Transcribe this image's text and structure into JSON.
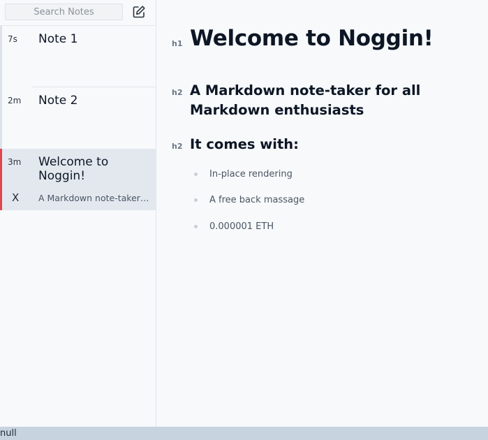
{
  "search": {
    "placeholder": "Search Notes"
  },
  "sidebar": {
    "new_note_icon": "edit-icon",
    "notes": [
      {
        "age": "7s",
        "title": "Note 1",
        "active": false
      },
      {
        "age": "2m",
        "title": "Note 2",
        "active": false
      },
      {
        "age": "3m",
        "title": "Welcome to Noggin!",
        "active": true,
        "delete_label": "X",
        "preview": "A Markdown note-taker for all Markdown enthusiasts"
      }
    ]
  },
  "document": {
    "h1": {
      "tag": "h1",
      "text": "Welcome to Noggin!"
    },
    "h2_first": {
      "tag": "h2",
      "text": "A Markdown note-taker for all Markdown enthusiasts"
    },
    "h2_second": {
      "tag": "h2",
      "text": "It comes with:"
    },
    "list": [
      "In-place rendering",
      "A free back massage",
      "0.000001 ETH"
    ]
  },
  "status_bar": {
    "text": "null"
  },
  "colors": {
    "accent": "#e0464e",
    "active_bg": "#e3e8ef",
    "status_bg": "#c8d3e0"
  }
}
